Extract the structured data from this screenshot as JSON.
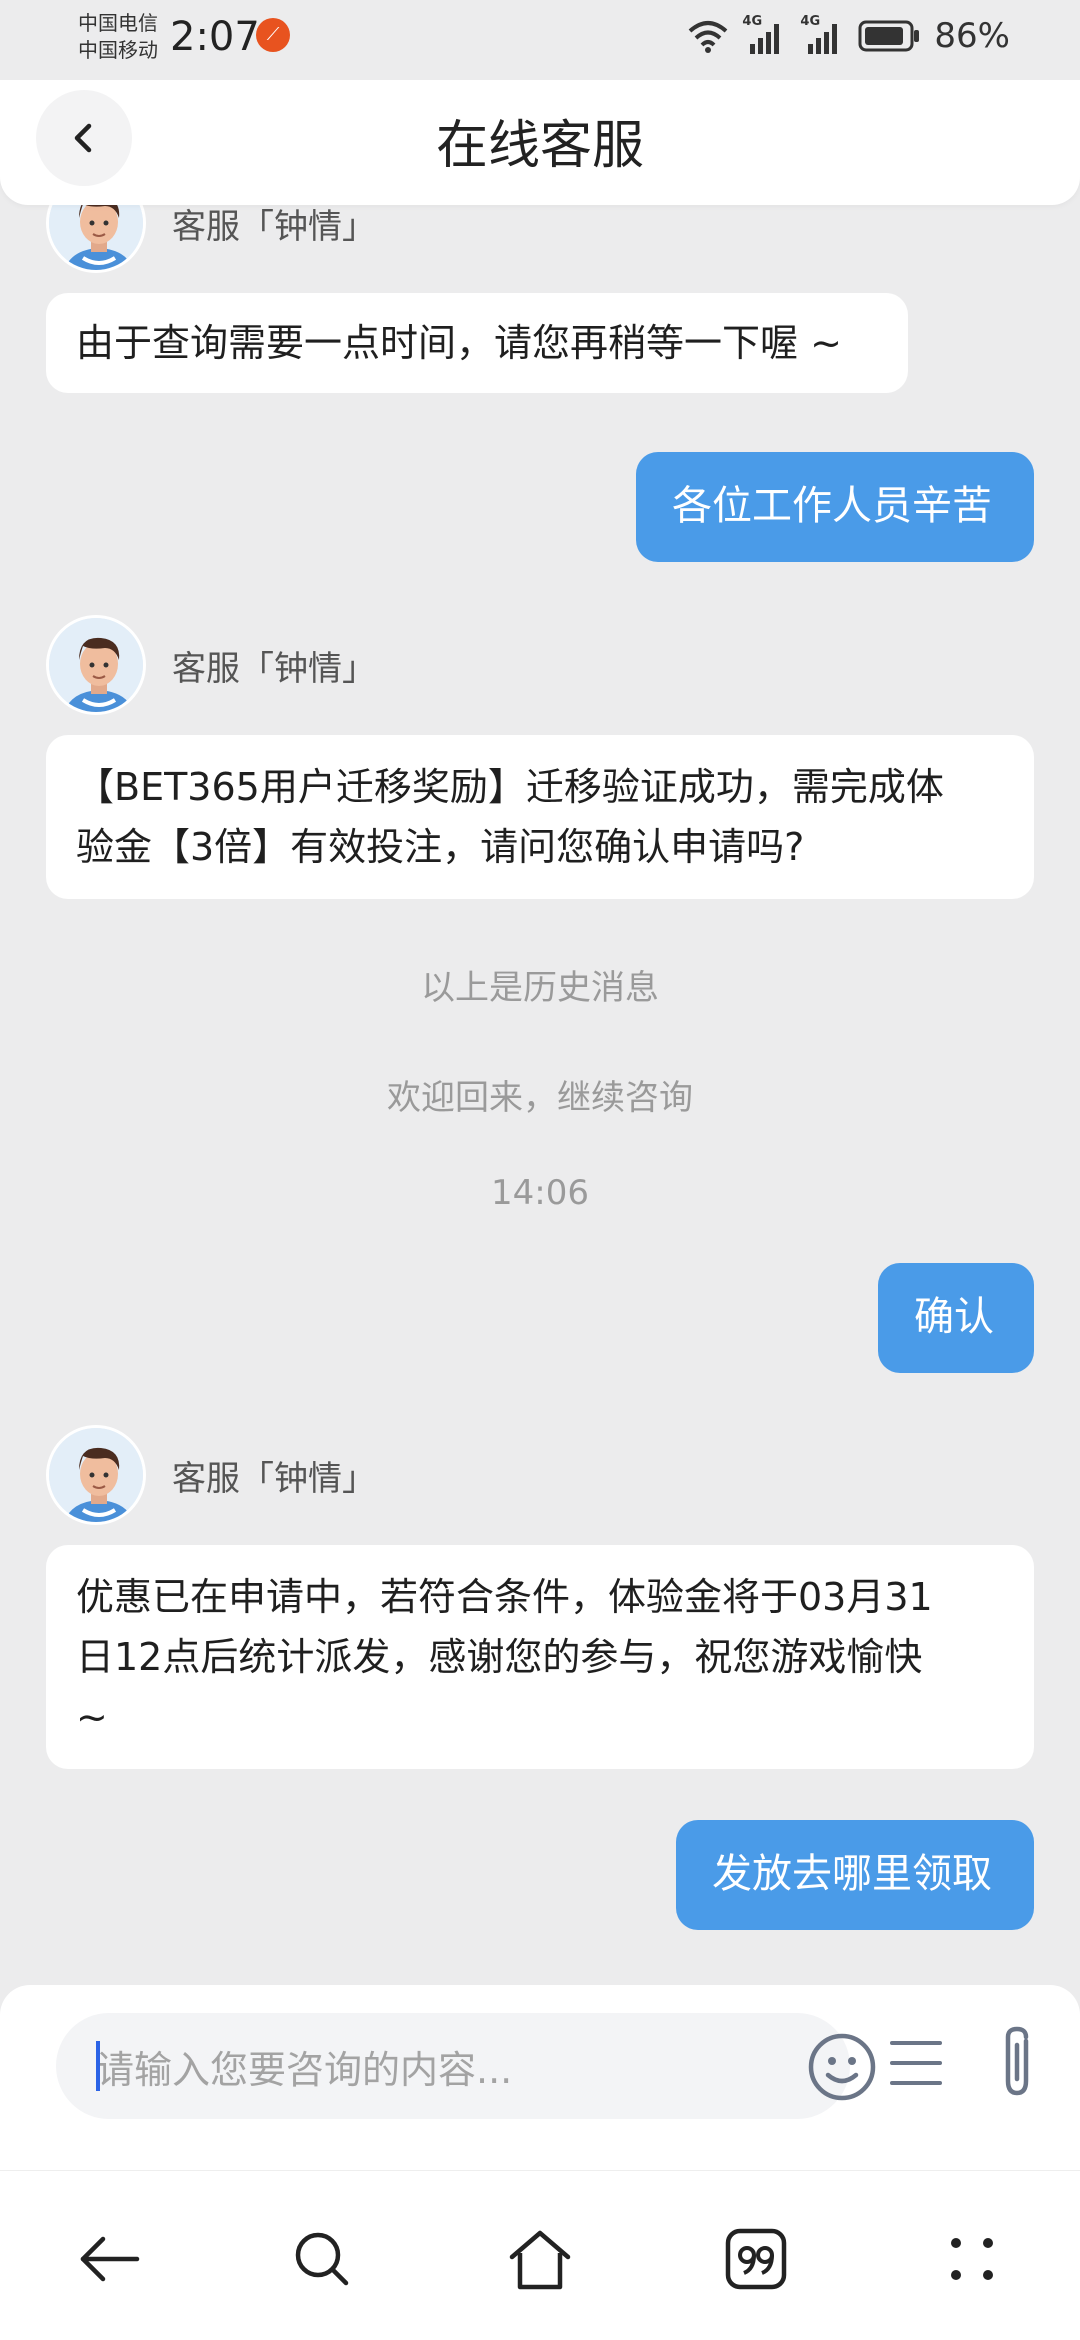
{
  "status_bar": {
    "carrier_1": "中国电信",
    "carrier_2": "中国移动",
    "time": "2:07",
    "network_1": "4G",
    "network_2": "4G",
    "battery": "86%"
  },
  "header": {
    "title": "在线客服"
  },
  "messages": {
    "m1_agent": "客服「钟情」",
    "m1_text": "由于查询需要一点时间，请您再稍等一下喔 ~",
    "m2_user": "各位工作人员辛苦",
    "m3_agent": "客服「钟情」",
    "m3_line1": "【BET365用户迁移奖励】迁移验证成功，需完成体",
    "m3_line2": "验金【3倍】有效投注，请问您确认申请吗?",
    "sys_history": "以上是历史消息",
    "sys_welcome": "欢迎回来，继续咨询",
    "sys_time": "14:06",
    "m4_user": "确认",
    "m5_agent": "客服「钟情」",
    "m5_line1": "优惠已在申请中，若符合条件，体验金将于03月31",
    "m5_line2": "日12点后统计派发，感谢您的参与，祝您游戏愉快",
    "m5_line3": "~",
    "m6_user": "发放去哪里领取"
  },
  "input": {
    "placeholder": "请输入您要咨询的内容..."
  },
  "colors": {
    "user_bubble": "#4a9be8",
    "background": "#ececed",
    "header_bg": "#ffffff"
  },
  "icons": [
    "back-icon",
    "emoji-icon",
    "menu-icon",
    "attachment-icon",
    "nav-back-icon",
    "nav-search-icon",
    "nav-home-icon",
    "nav-quote-icon",
    "nav-more-icon"
  ]
}
